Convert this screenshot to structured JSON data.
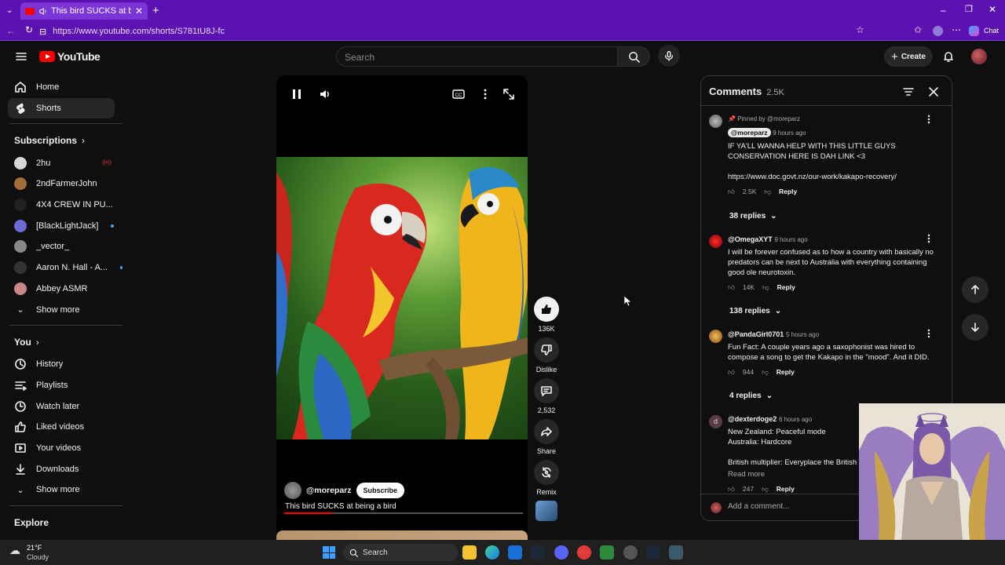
{
  "browser": {
    "tab_title": "This bird SUCKS at being a bi",
    "url": "https://www.youtube.com/shorts/S781tU8J-fc",
    "chat_label": "Chat"
  },
  "youtube": {
    "logo_text": "YouTube",
    "search_placeholder": "Search",
    "create_label": "Create"
  },
  "sidebar": {
    "main": [
      {
        "label": "Home",
        "icon": "home-icon"
      },
      {
        "label": "Shorts",
        "icon": "shorts-icon",
        "active": true
      }
    ],
    "subscriptions_title": "Subscriptions",
    "subscriptions": [
      {
        "label": "2hu",
        "color": "#d8d8d8",
        "badge": "live"
      },
      {
        "label": "2ndFarmerJohn",
        "color": "#a36d3a"
      },
      {
        "label": "4X4 CREW IN PU...",
        "color": "#222222",
        "badge": "dot"
      },
      {
        "label": "[BlackLightJack]",
        "color": "#6b6bd6",
        "badge": "dot"
      },
      {
        "label": "_vector_",
        "color": "#888888"
      },
      {
        "label": "Aaron N. Hall - A...",
        "color": "#333333",
        "badge": "dot"
      },
      {
        "label": "Abbey ASMR",
        "color": "#c8898a"
      }
    ],
    "subs_show_more": "Show more",
    "you_title": "You",
    "you_items": [
      {
        "label": "History",
        "icon": "history-icon"
      },
      {
        "label": "Playlists",
        "icon": "playlists-icon"
      },
      {
        "label": "Watch later",
        "icon": "watch-later-icon"
      },
      {
        "label": "Liked videos",
        "icon": "liked-videos-icon"
      },
      {
        "label": "Your videos",
        "icon": "your-videos-icon"
      },
      {
        "label": "Downloads",
        "icon": "downloads-icon"
      }
    ],
    "you_show_more": "Show more",
    "explore_title": "Explore"
  },
  "short": {
    "channel": "@moreparz",
    "subscribe_label": "Subscribe",
    "title": "This bird SUCKS at being a bird",
    "progress": 0.2
  },
  "actions": {
    "like_count": "136K",
    "dislike_label": "Dislike",
    "comment_count": "2,532",
    "share_label": "Share",
    "remix_label": "Remix"
  },
  "comments": {
    "title": "Comments",
    "count": "2.5K",
    "add_placeholder": "Add a comment...",
    "pinned_label": "Pinned by @moreparz",
    "list": [
      {
        "handle": "@moreparz",
        "time": "9 hours ago",
        "text": "IF YA'LL WANNA HELP WITH THIS LITTLE GUYS CONSERVATION HERE IS DAH LINK <3",
        "link": "https://www.doc.govt.nz/our-work/kakapo-recovery/",
        "likes": "2.5K",
        "replies": "38 replies"
      },
      {
        "handle": "@OmegaXYT",
        "time": "9 hours ago",
        "text": "I will be forever confused as to how a country with basically no predators can be next to Australia with everything containing good ole neurotoxin.",
        "likes": "14K",
        "replies": "138 replies"
      },
      {
        "handle": "@PandaGirl0701",
        "time": "5 hours ago",
        "text": "Fun Fact: A couple years ago a saxophonist was hired to compose a song to get the Kakapo in the \"mood\". And it DID.",
        "likes": "944",
        "replies": "4 replies"
      },
      {
        "handle": "@dexterdoge2",
        "time": "6 hours ago",
        "line1": "New Zealand: Peaceful mode",
        "line2": "Australia: Hardcore",
        "line3": "British multiplier: Everyplace the British v",
        "read_more": "Read more",
        "likes": "247"
      }
    ],
    "reply_label": "Reply",
    "avatar_initial": "d"
  },
  "taskbar": {
    "temp": "21°F",
    "condition": "Cloudy",
    "search_label": "Search"
  },
  "colors": {
    "browser_purple": "#5b12b0",
    "youtube_red": "#ff0000",
    "link_blue": "#3ea6ff"
  }
}
